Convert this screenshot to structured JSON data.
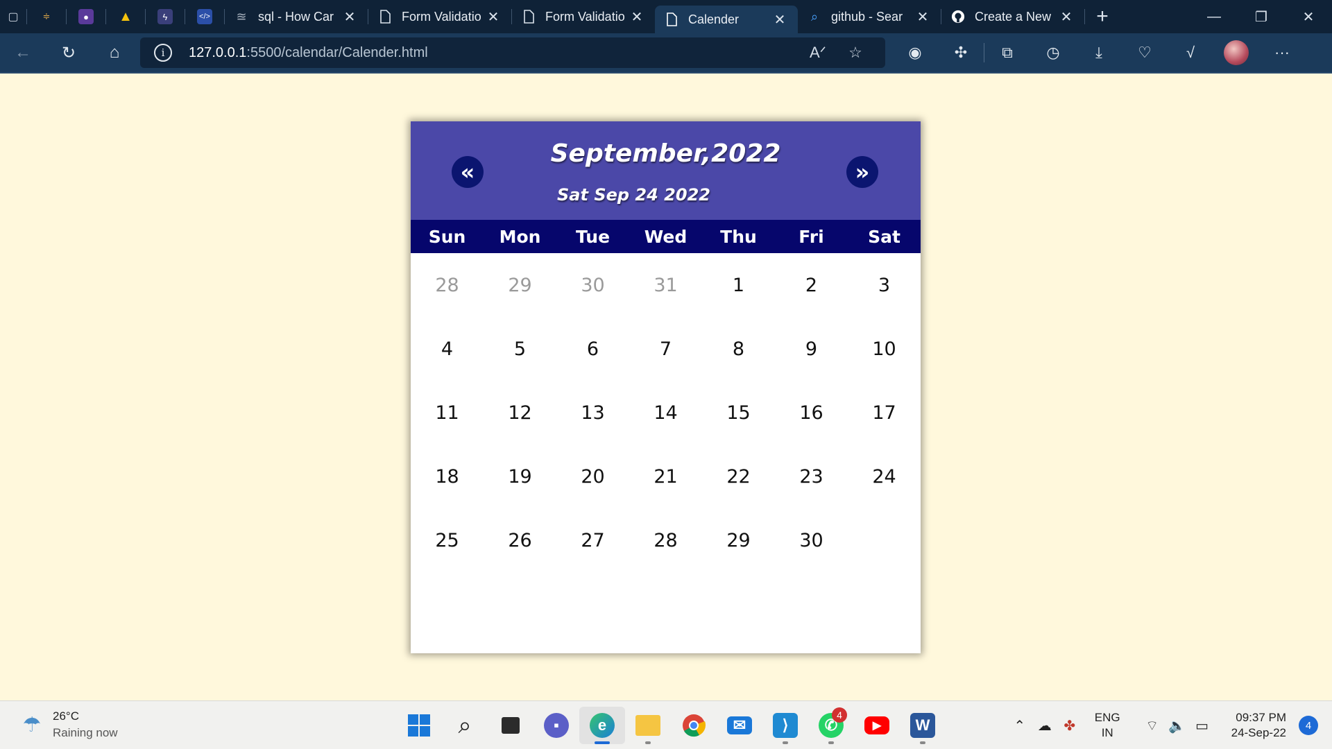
{
  "browser": {
    "tabs": [
      {
        "title": "sql - How Car",
        "icon": "stack-overflow-icon",
        "active": false
      },
      {
        "title": "Form Validatio",
        "icon": "page-icon",
        "active": false
      },
      {
        "title": "Form Validatio",
        "icon": "page-icon",
        "active": false
      },
      {
        "title": "Calender",
        "icon": "page-icon",
        "active": true
      },
      {
        "title": "github - Sear",
        "icon": "search-icon",
        "active": false
      },
      {
        "title": "Create a New",
        "icon": "github-icon",
        "active": false
      }
    ],
    "address": {
      "host": "127.0.0.1",
      "rest": ":5500/calendar/Calender.html"
    }
  },
  "calendar": {
    "month_title": "September,2022",
    "current_date": "Sat Sep 24 2022",
    "prev_label": "«",
    "next_label": "»",
    "weekdays": [
      "Sun",
      "Mon",
      "Tue",
      "Wed",
      "Thu",
      "Fri",
      "Sat"
    ],
    "prev_month_days": [
      "28",
      "29",
      "30",
      "31"
    ],
    "days": [
      "1",
      "2",
      "3",
      "4",
      "5",
      "6",
      "7",
      "8",
      "9",
      "10",
      "11",
      "12",
      "13",
      "14",
      "15",
      "16",
      "17",
      "18",
      "19",
      "20",
      "21",
      "22",
      "23",
      "24",
      "25",
      "26",
      "27",
      "28",
      "29",
      "30"
    ],
    "colors": {
      "header": "#4b48a8",
      "weekday_bar": "#06066c",
      "nav_button": "#0b1570",
      "page_bg": "#fff8dc"
    }
  },
  "taskbar": {
    "weather": {
      "temp": "26°C",
      "condition": "Raining now"
    },
    "whatsapp_badge": "4",
    "language": {
      "line1": "ENG",
      "line2": "IN"
    },
    "clock": {
      "time": "09:37 PM",
      "date": "24-Sep-22"
    },
    "notifications": "4"
  }
}
